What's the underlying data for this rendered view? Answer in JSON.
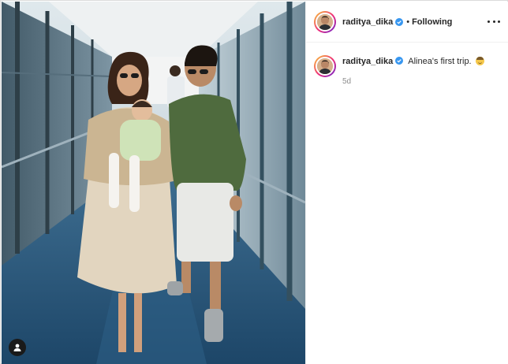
{
  "post": {
    "username": "raditya_dika",
    "follow_state": "Following",
    "separator": "•",
    "caption": "Alinea's first trip.",
    "caption_emoji": "baby-face-emoji",
    "timestamp": "5d"
  },
  "icons": {
    "verified": "verified-badge-icon",
    "more": "more-options-icon",
    "user_tag": "user-tag-icon"
  },
  "colors": {
    "text": "#262626",
    "secondary_text": "#8e8e8e",
    "verified_blue": "#3897f0",
    "border": "#dbdbdb"
  }
}
